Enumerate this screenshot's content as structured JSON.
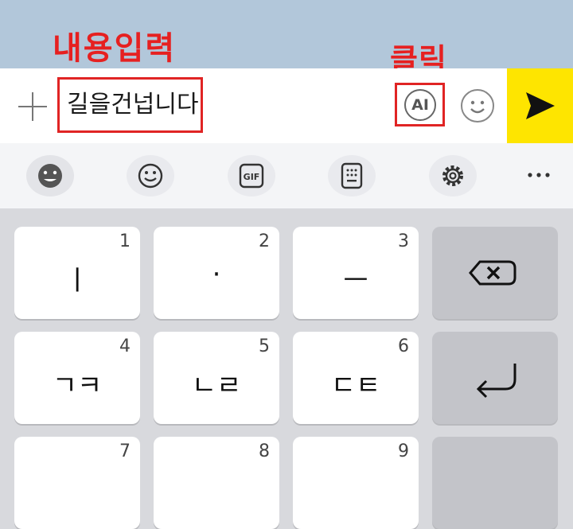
{
  "annotations": {
    "input_label": "내용입력",
    "click_label": "클릭"
  },
  "input_bar": {
    "text_value": "길을건넙니다",
    "ai_label": "AI",
    "send_color": "#fee500"
  },
  "toolbar": {
    "items": [
      "emoji-icon",
      "smile-icon",
      "gif-icon",
      "keypad-icon",
      "gear-icon",
      "more-icon"
    ],
    "gif_label": "GIF"
  },
  "keyboard": {
    "keys": [
      {
        "num": "1",
        "main": "ㅣ"
      },
      {
        "num": "2",
        "main": "·"
      },
      {
        "num": "3",
        "main": "ㅡ"
      },
      {
        "num": "4",
        "main": "ㄱㅋ"
      },
      {
        "num": "5",
        "main": "ㄴㄹ"
      },
      {
        "num": "6",
        "main": "ㄷㅌ"
      },
      {
        "num": "7",
        "main": ""
      },
      {
        "num": "8",
        "main": ""
      },
      {
        "num": "9",
        "main": ""
      }
    ]
  }
}
